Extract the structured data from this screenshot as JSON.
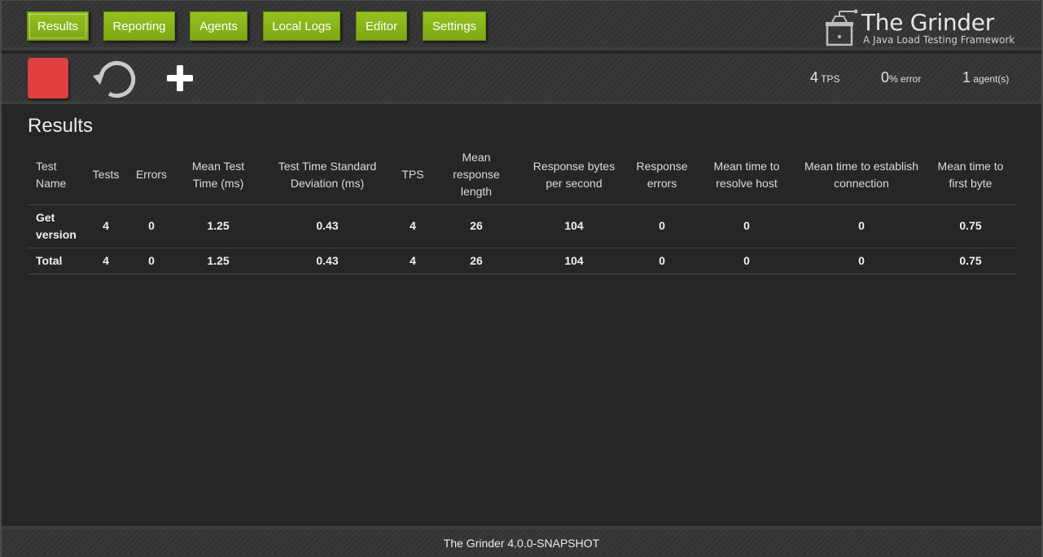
{
  "nav": {
    "items": [
      {
        "label": "Results",
        "active": true
      },
      {
        "label": "Reporting",
        "active": false
      },
      {
        "label": "Agents",
        "active": false
      },
      {
        "label": "Local Logs",
        "active": false
      },
      {
        "label": "Editor",
        "active": false
      },
      {
        "label": "Settings",
        "active": false
      }
    ]
  },
  "brand": {
    "title": "The Grinder",
    "subtitle": "A Java Load Testing Framework",
    "icon": "grinder-icon"
  },
  "controls": {
    "stop_icon": "stop-icon",
    "reset_icon": "reset-icon",
    "add_icon": "plus-icon",
    "stats": {
      "tps_value": "4",
      "tps_label": "TPS",
      "error_value": "0",
      "error_label": "% error",
      "agents_value": "1",
      "agents_label": "agent(s)"
    }
  },
  "results": {
    "title": "Results",
    "columns": [
      "Test Name",
      "Tests",
      "Errors",
      "Mean Test Time (ms)",
      "Test Time Standard Deviation (ms)",
      "TPS",
      "Mean response length",
      "Response bytes per second",
      "Response errors",
      "Mean time to resolve host",
      "Mean time to establish connection",
      "Mean time to first byte"
    ],
    "rows": [
      [
        "Get version",
        "4",
        "0",
        "1.25",
        "0.43",
        "4",
        "26",
        "104",
        "0",
        "0",
        "0",
        "0.75"
      ],
      [
        "Total",
        "4",
        "0",
        "1.25",
        "0.43",
        "4",
        "26",
        "104",
        "0",
        "0",
        "0",
        "0.75"
      ]
    ]
  },
  "colors": {
    "accent": "#8cb91b",
    "stop": "#e0403f",
    "background": "#262626"
  },
  "footer": {
    "text": "The Grinder 4.0.0-SNAPSHOT"
  }
}
